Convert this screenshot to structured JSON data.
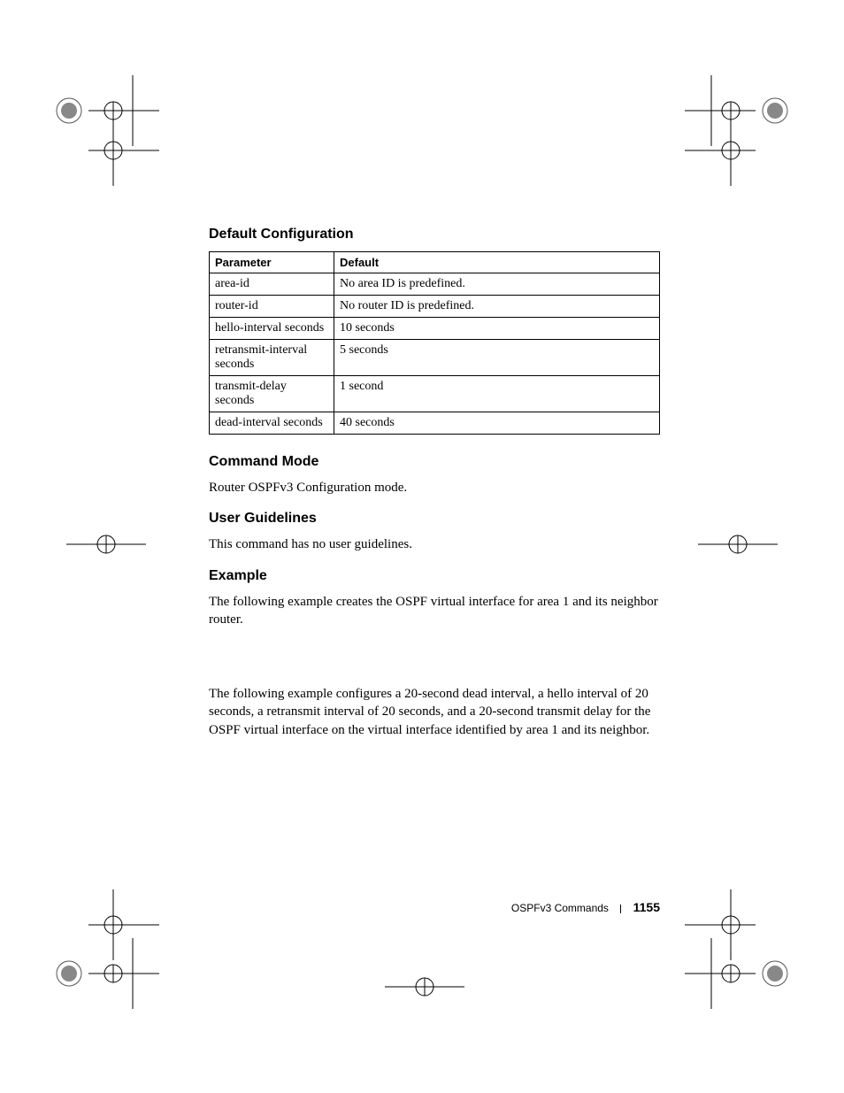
{
  "headings": {
    "default_config": "Default Configuration",
    "command_mode": "Command Mode",
    "user_guidelines": "User Guidelines",
    "example": "Example"
  },
  "table": {
    "header_param": "Parameter",
    "header_default": "Default",
    "rows": [
      {
        "param": "area-id",
        "default": "No area ID is predefined."
      },
      {
        "param": "router-id",
        "default": "No router ID is predefined."
      },
      {
        "param": "hello-interval seconds",
        "default": "10 seconds"
      },
      {
        "param": "retransmit-interval seconds",
        "default": "5 seconds"
      },
      {
        "param": "transmit-delay seconds",
        "default": "1 second"
      },
      {
        "param": "dead-interval seconds",
        "default": "40 seconds"
      }
    ]
  },
  "text": {
    "command_mode": "Router OSPFv3 Configuration mode.",
    "user_guidelines": "This command has no user guidelines.",
    "example_intro": "The following example creates the OSPF virtual interface for area 1 and its neighbor router.",
    "example_second": "The following example configures a 20-second dead interval, a hello interval of 20 seconds, a retransmit interval of 20 seconds, and a 20-second transmit delay for the OSPF virtual interface on the virtual interface identified by area 1 and its neighbor."
  },
  "footer": {
    "section": "OSPFv3 Commands",
    "page": "1155"
  }
}
